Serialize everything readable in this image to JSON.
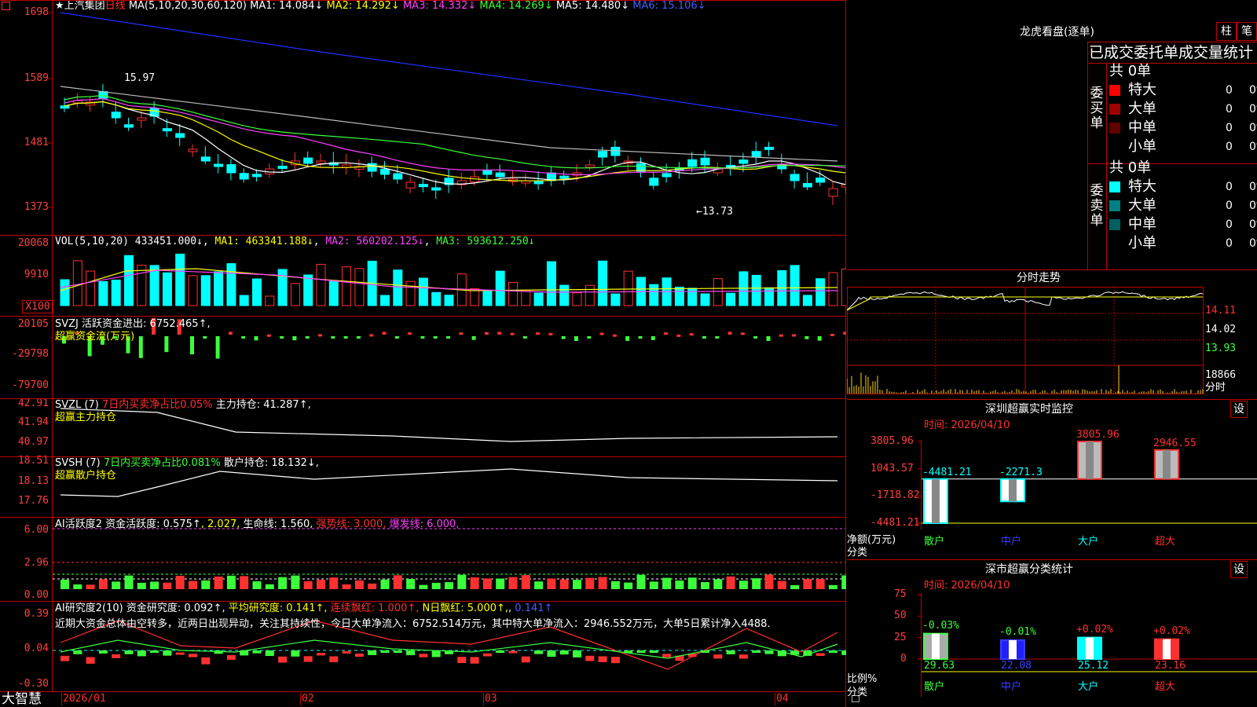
{
  "corner_icon": "stock-switch-icon",
  "header": {
    "title": "★上汽集团",
    "period": "日线",
    "ma_label": "MA(5,10,20,30,60,120)",
    "ma1": "MA1: 14.084↓",
    "ma2": "MA2: 14.292↓",
    "ma3": "MA3: 14.332↓",
    "ma4": "MA4: 14.269↓",
    "ma5": "MA5: 14.480↓",
    "ma6": "MA6: 15.106↓"
  },
  "price_axis": [
    "1698",
    "1589",
    "1481",
    "1373"
  ],
  "price_marks": {
    "high": "15.97",
    "low": "←13.73"
  },
  "vol": {
    "label": "VOL(5,10,20)",
    "value": "433451.000↓",
    "ma1": "MA1: 463341.188↓",
    "ma2": "MA2: 560202.125↓",
    "ma3": "MA3: 593612.250↓",
    "axis": [
      "20068",
      "9910",
      "X100"
    ]
  },
  "svzj": {
    "label": "SVZJ",
    "desc": "活跃资金进出: 6752.465↑",
    "sub": "超赢资金流(万元)",
    "axis": [
      "20105",
      "-29798",
      "-79700"
    ]
  },
  "svzl": {
    "label": "SVZL (7)",
    "desc1": "7日内买卖净占比0.05%",
    "desc2": "主力持仓: 41.287↑,",
    "sub": "超赢主力持仓",
    "axis": [
      "42.91",
      "41.94",
      "40.97"
    ]
  },
  "svsh": {
    "label": "SVSH (7)",
    "desc1": "7日内买卖净占比0.081%",
    "desc2": "散户持仓: 18.132↓,",
    "sub": "超赢散户持仓",
    "axis": [
      "18.51",
      "18.13",
      "17.76"
    ]
  },
  "ai_active": {
    "label": "AI活跃度2",
    "desc1": "资金活跃度: 0.575↑",
    "desc2": ", 2.027,",
    "desc3": "生命线: 1.560,",
    "desc4": "强势线: 3.000,",
    "desc5": "爆发线: 6.000,",
    "axis": [
      "6.00",
      "2.96",
      "0.00"
    ]
  },
  "ai_research": {
    "label": "AI研究度2(10)",
    "desc1": "资金研究度: 0.092↑,",
    "desc2": "平均研究度: 0.141↑,",
    "desc3": "连续飘红: 1.000↑,",
    "desc4": "N日飘红: 5.000↑,",
    "desc5": "0.141↑",
    "note": "近期大资金总体由空转多，近两日出现异动，关注其持续性，今日大单净流入：6752.514万元，其中特大单净流入：2946.552万元，大单5日累计净入4488.",
    "axis": [
      "0.39",
      "0.04",
      "-0.30"
    ]
  },
  "x_axis": {
    "brand": "大智慧",
    "labels": [
      "2026/01",
      "02",
      "03",
      "04"
    ]
  },
  "lhb": {
    "title": "龙虎看盘(逐单)",
    "btn_bar": "柱",
    "btn_count": "笔",
    "subtitle": "已成交委托单成交量统计",
    "buy_label": "委买单",
    "sell_label": "委卖单",
    "buy_total": "共 0单",
    "sell_total": "共 0单",
    "buy_rows": [
      {
        "name": "特大",
        "count": "0",
        "pct": "0%",
        "color": "#ff0000"
      },
      {
        "name": "大单",
        "count": "0",
        "pct": "0%",
        "color": "#a00000"
      },
      {
        "name": "中单",
        "count": "0",
        "pct": "0%",
        "color": "#600000"
      },
      {
        "name": "小单",
        "count": "0",
        "pct": "0%",
        "color": ""
      }
    ],
    "sell_rows": [
      {
        "name": "特大",
        "count": "0",
        "pct": "0%",
        "color": "#00ffff"
      },
      {
        "name": "大单",
        "count": "0",
        "pct": "0%",
        "color": "#008080"
      },
      {
        "name": "中单",
        "count": "0",
        "pct": "0%",
        "color": "#006060"
      },
      {
        "name": "小单",
        "count": "0",
        "pct": "0%",
        "color": ""
      }
    ]
  },
  "intraday": {
    "title": "分时走势",
    "axis": [
      "14.11",
      "14.02",
      "13.93",
      "18866",
      "分时"
    ]
  },
  "sz_monitor": {
    "title": "深圳超赢实时监控",
    "btn": "设",
    "time": "时间: 2026/04/10",
    "axis": [
      "3805.96",
      "1043.57",
      "-1718.82",
      "-4481.21"
    ],
    "ylabel": "净额(万元)",
    "xlabel": "分类",
    "chart_data": {
      "type": "bar",
      "categories": [
        "散户",
        "中户",
        "大户",
        "超大"
      ],
      "values": [
        -4481.21,
        -2271.3,
        3805.96,
        2946.55
      ],
      "value_labels": [
        "-4481.21",
        "-2271.3",
        "3805.96",
        "2946.55"
      ],
      "ylim": [
        -4481.21,
        3805.96
      ]
    }
  },
  "sz_class": {
    "title": "深市超赢分类统计",
    "btn": "设",
    "time": "时间: 2026/04/10",
    "axis": [
      "75",
      "50",
      "25",
      "0"
    ],
    "ylabel": "比例%",
    "xlabel": "分类",
    "chart_data": {
      "type": "bar",
      "categories": [
        "散户",
        "中户",
        "大户",
        "超大"
      ],
      "values": [
        29.63,
        22.08,
        25.12,
        23.16
      ],
      "value_labels": [
        "29.63",
        "22.08",
        "25.12",
        "23.16"
      ],
      "change_labels": [
        "-0.03%",
        "-0.01%",
        "+0.02%",
        "+0.02%"
      ],
      "ylim": [
        0,
        75
      ]
    }
  }
}
